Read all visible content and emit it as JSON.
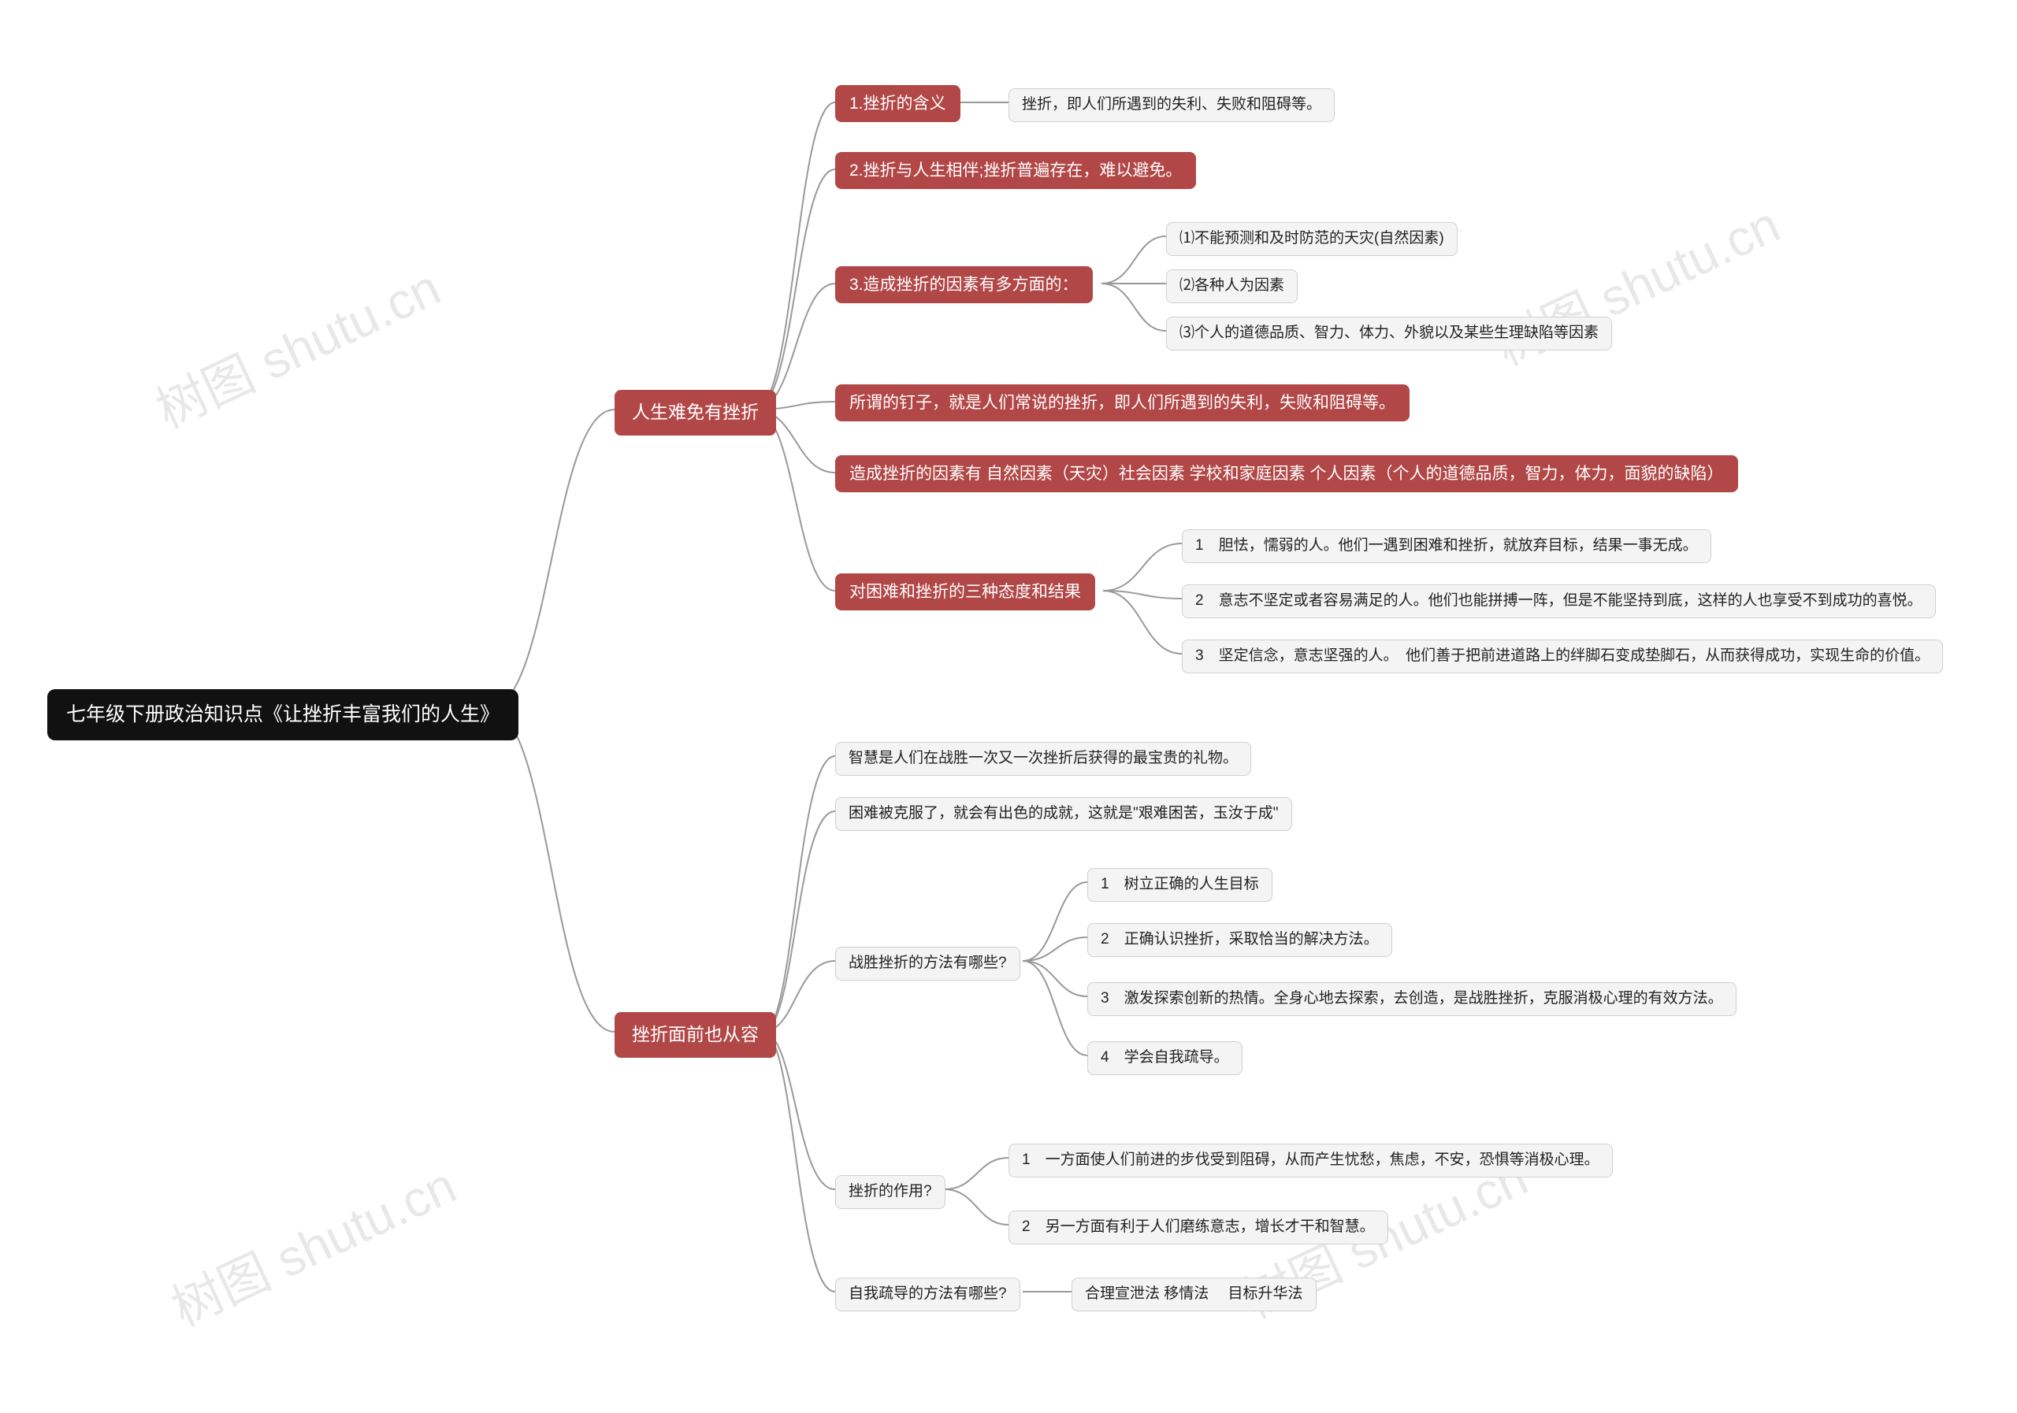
{
  "watermark": "树图 shutu.cn",
  "root": "七年级下册政治知识点《让挫折丰富我们的人生》",
  "branch1": {
    "title": "人生难免有挫折",
    "n1": {
      "label": "1.挫折的含义",
      "child": "挫折，即人们所遇到的失利、失败和阻碍等。"
    },
    "n2": "2.挫折与人生相伴;挫折普遍存在，难以避免。",
    "n3": {
      "label": "3.造成挫折的因素有多方面的：",
      "c1": "⑴不能预测和及时防范的天灾(自然因素)",
      "c2": "⑵各种人为因素",
      "c3": "⑶个人的道德品质、智力、体力、外貌以及某些生理缺陷等因素"
    },
    "n4": "所谓的钉子，就是人们常说的挫折，即人们所遇到的失利，失败和阻碍等。",
    "n5": "造成挫折的因素有 自然因素（天灾）社会因素 学校和家庭因素 个人因素（个人的道德品质，智力，体力，面貌的缺陷）",
    "n6": {
      "label": "对困难和挫折的三种态度和结果",
      "c1": "1　胆怯，懦弱的人。他们一遇到困难和挫折，就放弃目标，结果一事无成。",
      "c2": "2　意志不坚定或者容易满足的人。他们也能拼搏一阵，但是不能坚持到底，这样的人也享受不到成功的喜悦。",
      "c3": "3　坚定信念，意志坚强的人。　他们善于把前进道路上的绊脚石变成垫脚石，从而获得成功，实现生命的价值。"
    }
  },
  "branch2": {
    "title": "挫折面前也从容",
    "n1": "智慧是人们在战胜一次又一次挫折后获得的最宝贵的礼物。",
    "n2": "困难被克服了，就会有出色的成就，这就是\"艰难困苦，玉汝于成\"",
    "n3": {
      "label": "战胜挫折的方法有哪些?",
      "c1": "1　树立正确的人生目标",
      "c2": "2　正确认识挫折，采取恰当的解决方法。",
      "c3": "3　激发探索创新的热情。全身心地去探索，去创造，是战胜挫折，克服消极心理的有效方法。",
      "c4": "4　学会自我疏导。"
    },
    "n4": {
      "label": "挫折的作用?",
      "c1": "1　一方面使人们前进的步伐受到阻碍，从而产生忧愁，焦虑，不安，恐惧等消极心理。",
      "c2": "2　另一方面有利于人们磨练意志，增长才干和智慧。"
    },
    "n5": {
      "label": "自我疏导的方法有哪些?",
      "child": "合理宣泄法 移情法　 目标升华法"
    }
  }
}
